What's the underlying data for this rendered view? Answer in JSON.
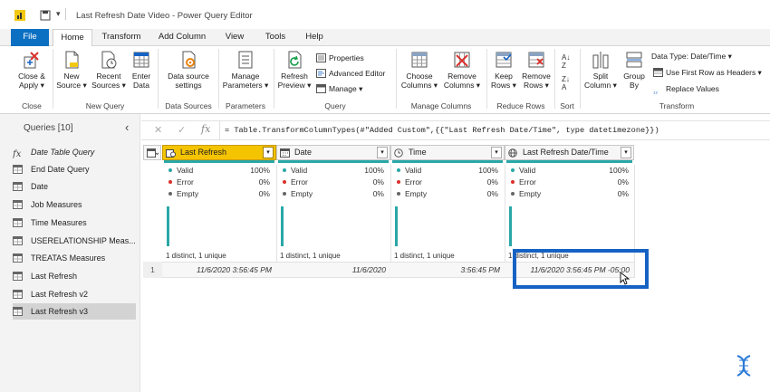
{
  "app": {
    "title": "Last Refresh Date Video - Power Query Editor"
  },
  "tabs": [
    {
      "label": "File"
    },
    {
      "label": "Home"
    },
    {
      "label": "Transform"
    },
    {
      "label": "Add Column"
    },
    {
      "label": "View"
    },
    {
      "label": "Tools"
    },
    {
      "label": "Help"
    }
  ],
  "ribbon": {
    "close_apply": {
      "l1": "Close &",
      "l2": "Apply ▾"
    },
    "new_source": {
      "l1": "New",
      "l2": "Source ▾"
    },
    "recent_sources": {
      "l1": "Recent",
      "l2": "Sources ▾"
    },
    "enter_data": {
      "l1": "Enter",
      "l2": "Data"
    },
    "data_source_settings": {
      "l1": "Data source",
      "l2": "settings"
    },
    "manage_parameters": {
      "l1": "Manage",
      "l2": "Parameters ▾"
    },
    "refresh_preview": {
      "l1": "Refresh",
      "l2": "Preview ▾"
    },
    "properties": "Properties",
    "advanced_editor": "Advanced Editor",
    "manage": "Manage ▾",
    "choose_columns": {
      "l1": "Choose",
      "l2": "Columns ▾"
    },
    "remove_columns": {
      "l1": "Remove",
      "l2": "Columns ▾"
    },
    "keep_rows": {
      "l1": "Keep",
      "l2": "Rows ▾"
    },
    "remove_rows": {
      "l1": "Remove",
      "l2": "Rows ▾"
    },
    "split_column": {
      "l1": "Split",
      "l2": "Column ▾"
    },
    "group_by": {
      "l1": "Group",
      "l2": "By"
    },
    "data_type": "Data Type: Date/Time ▾",
    "first_row_headers": "Use First Row as Headers ▾",
    "replace_values": "Replace Values",
    "groups": {
      "close": "Close",
      "new_query": "New Query",
      "data_sources": "Data Sources",
      "parameters": "Parameters",
      "query": "Query",
      "manage_columns": "Manage Columns",
      "reduce_rows": "Reduce Rows",
      "sort": "Sort",
      "transform": "Transform"
    }
  },
  "queries": {
    "header": "Queries [10]",
    "items": [
      {
        "label": "Date Table Query",
        "kind": "fx"
      },
      {
        "label": "End Date Query",
        "kind": "table"
      },
      {
        "label": "Date",
        "kind": "table"
      },
      {
        "label": "Job Measures",
        "kind": "table"
      },
      {
        "label": "Time Measures",
        "kind": "table"
      },
      {
        "label": "USERELATIONSHIP Meas...",
        "kind": "table"
      },
      {
        "label": "TREATAS Measures",
        "kind": "table"
      },
      {
        "label": "Last Refresh",
        "kind": "table"
      },
      {
        "label": "Last Refresh v2",
        "kind": "table"
      },
      {
        "label": "Last Refresh v3",
        "kind": "table",
        "selected": true
      }
    ]
  },
  "formula": {
    "text": "= Table.TransformColumnTypes(#\"Added Custom\",{{\"Last Refresh Date/Time\", type datetimezone}})"
  },
  "grid": {
    "row_number": "1",
    "columns": [
      {
        "name": "Last Refresh",
        "type_icon": "datetime-icon",
        "valid": "100%",
        "error": "0%",
        "empty": "0%",
        "distinct": "1 distinct, 1 unique",
        "value": "11/6/2020 3:56:45 PM"
      },
      {
        "name": "Date",
        "type_icon": "date-icon",
        "valid": "100%",
        "error": "0%",
        "empty": "0%",
        "distinct": "1 distinct, 1 unique",
        "value": "11/6/2020"
      },
      {
        "name": "Time",
        "type_icon": "clock-icon",
        "valid": "100%",
        "error": "0%",
        "empty": "0%",
        "distinct": "1 distinct, 1 unique",
        "value": "3:56:45 PM"
      },
      {
        "name": "Last Refresh Date/Time",
        "type_icon": "globe-icon",
        "valid": "100%",
        "error": "0%",
        "empty": "0%",
        "distinct": "1 distinct, 1 unique",
        "value": "11/6/2020 3:56:45 PM -05:00"
      }
    ],
    "labels": {
      "valid": "Valid",
      "error": "Error",
      "empty": "Empty"
    }
  },
  "colors": {
    "accent": "#0b6fc2",
    "teal": "#2aa7a7",
    "highlight": "#1662c4",
    "selected_header": "#f5c400"
  }
}
